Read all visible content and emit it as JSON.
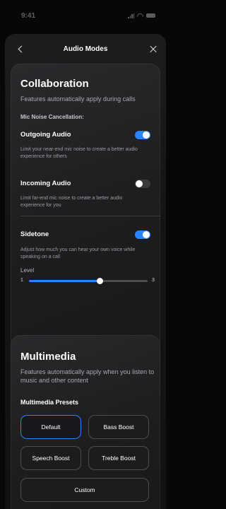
{
  "status_bar": {
    "time": "9:41"
  },
  "nav": {
    "title": "Audio Modes"
  },
  "collaboration": {
    "title": "Collaboration",
    "subtitle": "Features automatically apply during calls",
    "section_label": "Mic Noise Cancellation:",
    "outgoing": {
      "title": "Outgoing Audio",
      "description": "Limit your near-end mic noise to create a better audio experience for others",
      "enabled": true
    },
    "incoming": {
      "title": "Incoming Audio",
      "description": "Limit far-end mic noise to create a better audio experience for you",
      "enabled": false
    },
    "sidetone": {
      "title": "Sidetone",
      "description": "Adjust how much you can hear your own voice while speaking on a call",
      "enabled": true,
      "level_label": "Level",
      "min": "1",
      "max": "3",
      "value_fraction": 0.6
    }
  },
  "multimedia": {
    "title": "Multimedia",
    "subtitle": "Features automatically apply when you listen to music and other content",
    "presets_label": "Multimedia Presets",
    "presets": [
      {
        "label": "Default",
        "selected": true
      },
      {
        "label": "Bass Boost",
        "selected": false
      },
      {
        "label": "Speech Boost",
        "selected": false
      },
      {
        "label": "Treble Boost",
        "selected": false
      },
      {
        "label": "Custom",
        "selected": false
      }
    ]
  },
  "colors": {
    "accent": "#2a84ff",
    "background": "#070707",
    "card": "#232325"
  }
}
